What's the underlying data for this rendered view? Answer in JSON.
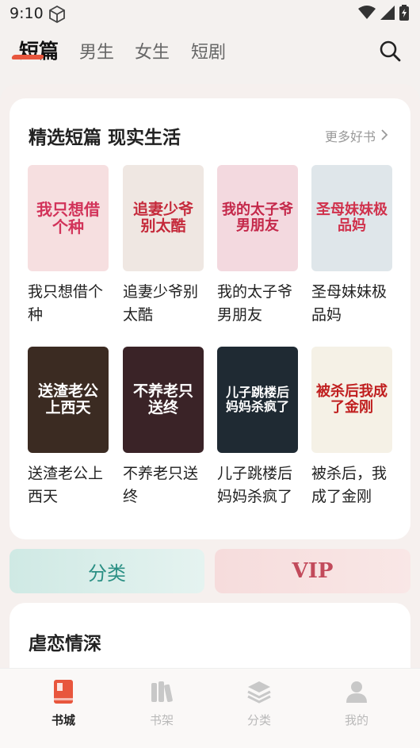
{
  "status": {
    "time": "9:10"
  },
  "tabs": [
    {
      "label": "短篇"
    },
    {
      "label": "男生"
    },
    {
      "label": "女生"
    },
    {
      "label": "短剧"
    }
  ],
  "section1": {
    "title": "精选短篇 现实生活",
    "more": "更多好书",
    "books": [
      {
        "title": "我只想借个种",
        "cover_text": "我只想借个种",
        "bg": "#f6dfe0",
        "fg": "#d2335a"
      },
      {
        "title": "追妻少爷别太酷",
        "cover_text": "追妻少爷别太酷",
        "bg": "#efe7e2",
        "fg": "#c52a3b"
      },
      {
        "title": "我的太子爷男朋友",
        "cover_text": "我的太子爷男朋友",
        "bg": "#f3d9df",
        "fg": "#c4284a"
      },
      {
        "title": "圣母妹妹极品妈",
        "cover_text": "圣母妹妹极品妈",
        "bg": "#dfe6ea",
        "fg": "#d0314c"
      },
      {
        "title": "送渣老公上西天",
        "cover_text": "送渣老公上西天",
        "bg": "#3b2b22",
        "fg": "#ffffff"
      },
      {
        "title": "不养老只送终",
        "cover_text": "不养老只送终",
        "bg": "#3a2327",
        "fg": "#ffffff"
      },
      {
        "title": "儿子跳楼后妈妈杀疯了",
        "cover_text": "儿子跳楼后妈妈杀疯了",
        "bg": "#1f2a33",
        "fg": "#ffffff"
      },
      {
        "title": "被杀后，我成了金刚",
        "cover_text": "被杀后我成了金刚",
        "bg": "#f5f1e6",
        "fg": "#c01f1f"
      }
    ]
  },
  "buttons": {
    "category": "分类",
    "vip": "VIP"
  },
  "section2": {
    "title": "虐恋情深"
  },
  "bottom_nav": [
    {
      "label": "书城"
    },
    {
      "label": "书架"
    },
    {
      "label": "分类"
    },
    {
      "label": "我的"
    }
  ],
  "colors": {
    "accent": "#e8563d"
  }
}
